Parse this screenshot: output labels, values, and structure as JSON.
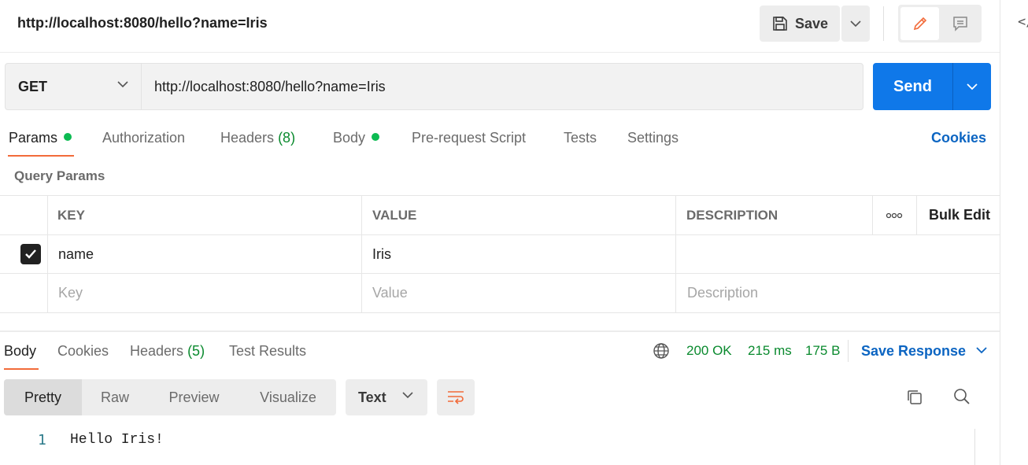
{
  "header": {
    "title": "http://localhost:8080/hello?name=Iris",
    "save_label": "Save"
  },
  "request": {
    "method": "GET",
    "url": "http://localhost:8080/hello?name=Iris",
    "send_label": "Send"
  },
  "request_tabs": {
    "params": "Params",
    "authorization": "Authorization",
    "headers": "Headers",
    "headers_count": "(8)",
    "body": "Body",
    "pre_request": "Pre-request Script",
    "tests": "Tests",
    "settings": "Settings",
    "cookies": "Cookies"
  },
  "query_params": {
    "title": "Query Params",
    "columns": {
      "key": "KEY",
      "value": "VALUE",
      "description": "DESCRIPTION",
      "bulk_edit": "Bulk Edit"
    },
    "rows": [
      {
        "checked": true,
        "key": "name",
        "value": "Iris",
        "description": ""
      }
    ],
    "placeholders": {
      "key": "Key",
      "value": "Value",
      "description": "Description"
    }
  },
  "response_tabs": {
    "body": "Body",
    "cookies": "Cookies",
    "headers": "Headers",
    "headers_count": "(5)",
    "test_results": "Test Results"
  },
  "response_status": {
    "status": "200 OK",
    "time": "215 ms",
    "size": "175 B",
    "save_response": "Save Response"
  },
  "response_view": {
    "modes": [
      "Pretty",
      "Raw",
      "Preview",
      "Visualize"
    ],
    "active_mode": "Pretty",
    "format": "Text"
  },
  "response_body": {
    "lines": [
      {
        "number": "1",
        "text": "Hello Iris!"
      }
    ]
  },
  "colors": {
    "accent": "#f26b3a",
    "send": "#0f78e9",
    "link": "#0c65c2",
    "success": "#0a8a2e",
    "dot": "#0cbb52"
  }
}
